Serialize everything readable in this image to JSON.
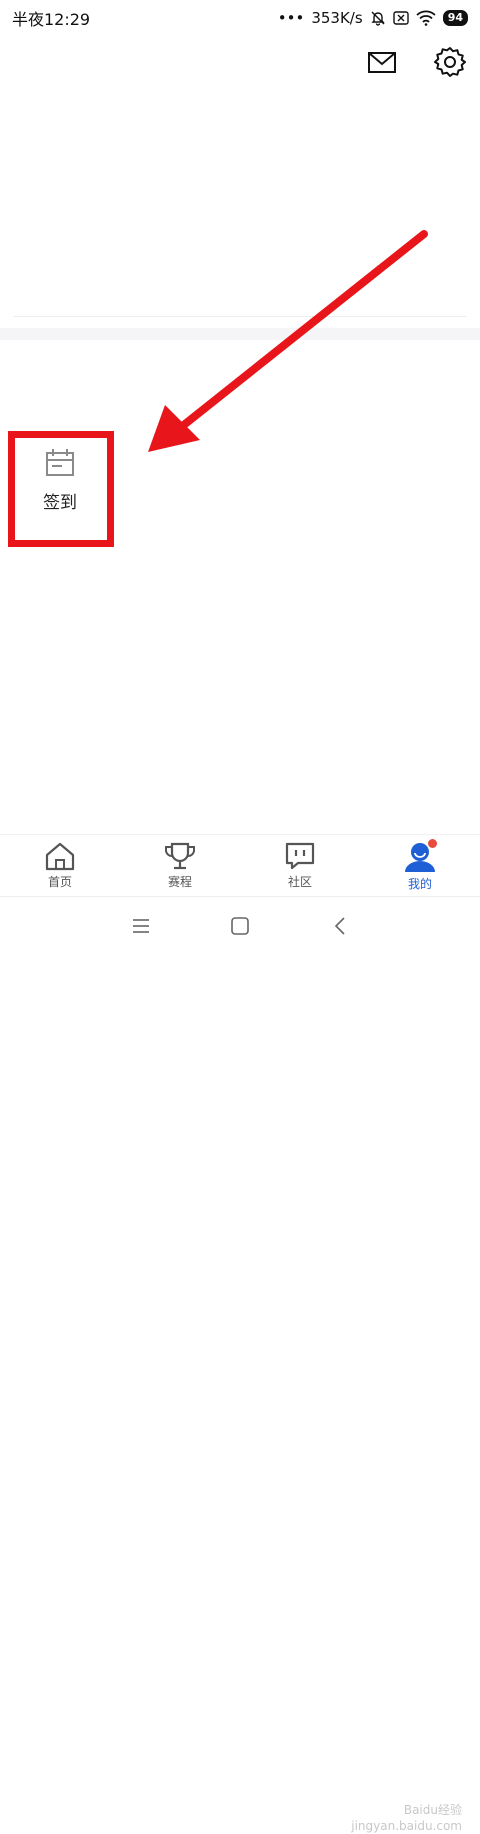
{
  "status_bar": {
    "time": "半夜12:29",
    "dots": "•••",
    "speed": "353K/s",
    "battery": "94"
  },
  "top_bar": {
    "icons": [
      "mail-icon",
      "settings-gear-icon"
    ]
  },
  "signin": {
    "label": "签到",
    "icon": "calendar-icon",
    "highlight_color": "#e8161a"
  },
  "tabs": [
    {
      "label": "首页",
      "icon": "home-icon",
      "active": false
    },
    {
      "label": "赛程",
      "icon": "trophy-icon",
      "active": false
    },
    {
      "label": "社区",
      "icon": "community-chat-icon",
      "active": false
    },
    {
      "label": "我的",
      "icon": "profile-icon",
      "active": true,
      "badge": true
    }
  ],
  "colors": {
    "active_tab": "#1f5fd6",
    "badge": "#e74c3c",
    "arrow": "#e8161a"
  },
  "watermark": {
    "line1": "Baidu经验",
    "line2": "jingyan.baidu.com"
  }
}
